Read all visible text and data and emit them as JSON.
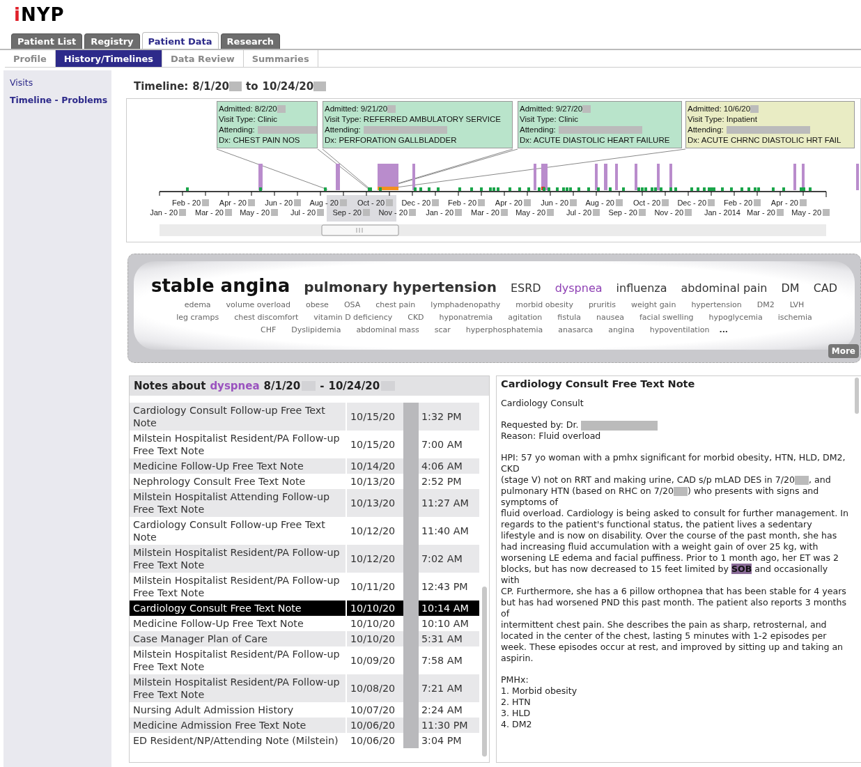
{
  "logo": "iNYP",
  "tabs": [
    {
      "label": "Patient List",
      "selected": false
    },
    {
      "label": "Registry",
      "selected": false
    },
    {
      "label": "Patient Data",
      "selected": true
    },
    {
      "label": "Research",
      "selected": false
    }
  ],
  "subtabs": [
    {
      "label": "Profile",
      "selected": false
    },
    {
      "label": "History/Timelines",
      "selected": true
    },
    {
      "label": "Data Review",
      "selected": false
    },
    {
      "label": "Summaries",
      "selected": false
    }
  ],
  "sidebar": {
    "items": [
      "Visits",
      "Timeline - Problems"
    ]
  },
  "timeline": {
    "label": "Timeline:",
    "start": "8/1/20",
    "separator": "to",
    "end": "10/24/20",
    "visits": [
      {
        "admitted": "Admitted: 8/2/20",
        "visit_type": "Visit Type: Clinic",
        "attending": "Attending:",
        "dx": "Dx: CHEST PAIN NOS",
        "color": "#b9e4cb"
      },
      {
        "admitted": "Admitted: 9/21/20",
        "visit_type": "Visit Type: REFERRED AMBULATORY SERVICE",
        "attending": "Attending:",
        "dx": "Dx: PERFORATION GALLBLADDER",
        "color": "#b9e4cb"
      },
      {
        "admitted": "Admitted: 9/27/20",
        "visit_type": "Visit Type: Clinic",
        "attending": "Attending:",
        "dx": "Dx: ACUTE DIASTOLIC HEART FAILURE",
        "color": "#b9e4cb"
      },
      {
        "admitted": "Admitted: 10/6/20",
        "visit_type": "Visit Type: Inpatient",
        "attending": "Attending:",
        "dx": "Dx: ACUTE CHRNC DIASTOLIC HRT FAIL",
        "color": "#e9ecc4"
      }
    ],
    "months": [
      {
        "label": "Jan - 20",
        "redacted": true
      },
      {
        "label": "Feb - 20",
        "redacted": true
      },
      {
        "label": "Mar - 20",
        "redacted": true
      },
      {
        "label": "Apr - 20",
        "redacted": true
      },
      {
        "label": "May - 20",
        "redacted": true
      },
      {
        "label": "Jun - 20",
        "redacted": true
      },
      {
        "label": "Jul - 20",
        "redacted": true
      },
      {
        "label": "Aug - 20",
        "redacted": true
      },
      {
        "label": "Sep - 20",
        "redacted": true
      },
      {
        "label": "Oct - 20",
        "redacted": true
      },
      {
        "label": "Nov - 20",
        "redacted": true
      },
      {
        "label": "Dec - 20",
        "redacted": true
      },
      {
        "label": "Jan - 20",
        "redacted": true
      },
      {
        "label": "Feb - 20",
        "redacted": true
      },
      {
        "label": "Mar - 20",
        "redacted": true
      },
      {
        "label": "Apr - 20",
        "redacted": true
      },
      {
        "label": "May - 20",
        "redacted": true
      },
      {
        "label": "Jun - 20",
        "redacted": true
      },
      {
        "label": "Jul - 20",
        "redacted": true
      },
      {
        "label": "Aug - 20",
        "redacted": true
      },
      {
        "label": "Sep - 20",
        "redacted": true
      },
      {
        "label": "Oct - 20",
        "redacted": true
      },
      {
        "label": "Nov - 20",
        "redacted": true
      },
      {
        "label": "Dec - 20",
        "redacted": true
      },
      {
        "label": "Jan - 2014",
        "redacted": false
      },
      {
        "label": "Feb - 20",
        "redacted": true
      },
      {
        "label": "Mar - 20",
        "redacted": true
      },
      {
        "label": "Apr - 20",
        "redacted": true
      },
      {
        "label": "May - 20",
        "redacted": true
      }
    ]
  },
  "problems": {
    "lines": [
      [
        {
          "label": "stable angina",
          "kind": "xl",
          "selected": false
        },
        {
          "label": "pulmonary hypertension",
          "kind": "lg",
          "selected": false
        },
        {
          "label": "ESRD",
          "kind": "md",
          "selected": false
        },
        {
          "label": "dyspnea",
          "kind": "md",
          "selected": true
        },
        {
          "label": "influenza",
          "kind": "md",
          "selected": false
        },
        {
          "label": "abdominal pain",
          "kind": "md",
          "selected": false
        },
        {
          "label": "DM",
          "kind": "md",
          "selected": false
        },
        {
          "label": "CAD",
          "kind": "md",
          "selected": false
        }
      ],
      [
        {
          "label": "edema",
          "kind": "sm",
          "selected": false
        },
        {
          "label": "volume overload",
          "kind": "sm",
          "selected": false
        },
        {
          "label": "obese",
          "kind": "sm",
          "selected": false
        },
        {
          "label": "OSA",
          "kind": "sm",
          "selected": false
        },
        {
          "label": "chest pain",
          "kind": "sm",
          "selected": false
        },
        {
          "label": "lymphadenopathy",
          "kind": "sm",
          "selected": false
        },
        {
          "label": "morbid obesity",
          "kind": "sm",
          "selected": false
        },
        {
          "label": "pruritis",
          "kind": "sm",
          "selected": false
        },
        {
          "label": "weight gain",
          "kind": "sm",
          "selected": false
        },
        {
          "label": "hypertension",
          "kind": "sm",
          "selected": false
        },
        {
          "label": "DM2",
          "kind": "sm",
          "selected": false
        },
        {
          "label": "LVH",
          "kind": "sm",
          "selected": false
        }
      ],
      [
        {
          "label": "leg cramps",
          "kind": "sm",
          "selected": false
        },
        {
          "label": "chest discomfort",
          "kind": "sm",
          "selected": false
        },
        {
          "label": "vitamin D deficiency",
          "kind": "sm",
          "selected": false
        },
        {
          "label": "CKD",
          "kind": "sm",
          "selected": false
        },
        {
          "label": "hyponatremia",
          "kind": "sm",
          "selected": false
        },
        {
          "label": "agitation",
          "kind": "sm",
          "selected": false
        },
        {
          "label": "fistula",
          "kind": "sm",
          "selected": false
        },
        {
          "label": "nausea",
          "kind": "sm",
          "selected": false
        },
        {
          "label": "facial swelling",
          "kind": "sm",
          "selected": false
        },
        {
          "label": "hypoglycemia",
          "kind": "sm",
          "selected": false
        },
        {
          "label": "ischemia",
          "kind": "sm",
          "selected": false
        }
      ],
      [
        {
          "label": "CHF",
          "kind": "sm",
          "selected": false
        },
        {
          "label": "Dyslipidemia",
          "kind": "sm",
          "selected": false
        },
        {
          "label": "abdominal mass",
          "kind": "sm",
          "selected": false
        },
        {
          "label": "scar",
          "kind": "sm",
          "selected": false
        },
        {
          "label": "hyperphosphatemia",
          "kind": "sm",
          "selected": false
        },
        {
          "label": "anasarca",
          "kind": "sm",
          "selected": false
        },
        {
          "label": "angina",
          "kind": "sm",
          "selected": false
        },
        {
          "label": "hypoventilation",
          "kind": "sm",
          "selected": false
        }
      ]
    ],
    "ellipsis": "...",
    "more": "More"
  },
  "notes": {
    "label": "Notes about",
    "problem": "dyspnea",
    "start": "8/1/20",
    "separator": "-",
    "end": "10/24/20",
    "rows": [
      {
        "title": "Cardiology Consult Follow-up Free Text Note",
        "date": "10/15/20",
        "time": "1:32 PM",
        "selected": false
      },
      {
        "title": "Milstein Hospitalist Resident/PA Follow-up Free Text Note",
        "date": "10/15/20",
        "time": "7:00 AM",
        "selected": false
      },
      {
        "title": "Medicine Follow-Up Free Text Note",
        "date": "10/14/20",
        "time": "4:06 AM",
        "selected": false
      },
      {
        "title": "Nephrology Consult Free Text Note",
        "date": "10/13/20",
        "time": "2:52 PM",
        "selected": false
      },
      {
        "title": "Milstein Hospitalist Attending Follow-up Free Text Note",
        "date": "10/13/20",
        "time": "11:27 AM",
        "selected": false
      },
      {
        "title": "Cardiology Consult Follow-up Free Text Note",
        "date": "10/12/20",
        "time": "11:40 AM",
        "selected": false
      },
      {
        "title": "Milstein Hospitalist Resident/PA Follow-up Free Text Note",
        "date": "10/12/20",
        "time": "7:02 AM",
        "selected": false
      },
      {
        "title": "Milstein Hospitalist Resident/PA Follow-up Free Text Note",
        "date": "10/11/20",
        "time": "12:43 PM",
        "selected": false
      },
      {
        "title": "Cardiology Consult Free Text Note",
        "date": "10/10/20",
        "time": "10:14 AM",
        "selected": true
      },
      {
        "title": "Medicine Follow-Up Free Text Note",
        "date": "10/10/20",
        "time": "10:10 AM",
        "selected": false
      },
      {
        "title": "Case Manager Plan of Care",
        "date": "10/10/20",
        "time": "5:31 AM",
        "selected": false
      },
      {
        "title": "Milstein Hospitalist Resident/PA Follow-up Free Text Note",
        "date": "10/09/20",
        "time": "7:58 AM",
        "selected": false
      },
      {
        "title": "Milstein Hospitalist Resident/PA Follow-up Free Text Note",
        "date": "10/08/20",
        "time": "7:21 AM",
        "selected": false
      },
      {
        "title": "Nursing Adult Admission History",
        "date": "10/07/20",
        "time": "2:24 AM",
        "selected": false
      },
      {
        "title": "Medicine Admission Free Text Note",
        "date": "10/06/20",
        "time": "11:30 PM",
        "selected": false
      },
      {
        "title": "ED Resident/NP/Attending Note (Milstein)",
        "date": "10/06/20",
        "time": "3:04 PM",
        "selected": false
      }
    ]
  },
  "note": {
    "title": "Cardiology Consult Free Text Note",
    "blocks": [
      [
        {
          "parts": [
            "Cardiology Consult"
          ]
        }
      ],
      [
        {
          "parts": [
            "Requested by: Dr."
          ],
          "trailing_redaction": true
        },
        {
          "parts": [
            "Reason: Fluid overload"
          ]
        }
      ],
      [
        {
          "parts": [
            "HPI: 57 yo woman with a pmhx significant for morbid obesity, HTN, HLD, DM2, CKD"
          ]
        },
        {
          "parts": [
            "(stage V) not on RRT and making urine, CAD s/p mLAD DES in 7/20",
            ", and pulmonary HTN (based on RHC on 7/20",
            ") who presents with signs and symptoms of"
          ]
        },
        {
          "parts": [
            "fluid overload. Cardiology  is being asked to consult for further management. In regards to the patient's functional status, the patient lives a sedentary lifestyle and is now on disability. Over the course of the past month, she has had increasing fluid accumulation with a weight gain of over 25 kg, with worsening LE edema and facial puffiness.  Prior to 1 month ago, her ET was 2"
          ]
        },
        {
          "parts": [
            "blocks, but has now decreased to 15 feet limited by **SOB** and  occasionally with"
          ]
        },
        {
          "parts": [
            "CP. Furthermore, she  has a 6 pillow orthopnea that has been stable for 4 years"
          ]
        },
        {
          "parts": [
            "but has had worsened PND this past month. The patient also reports 3 months of"
          ]
        },
        {
          "parts": [
            "intermittent chest pain. She describes the pain as sharp, retrosternal, and located in the center of the chest, lasting 5 minutes with 1-2 episodes per week. These episodes occur at rest, and improved by sitting up and taking an"
          ]
        },
        {
          "parts": [
            "aspirin."
          ]
        }
      ],
      [
        {
          "parts": [
            "PMHx:"
          ]
        },
        {
          "parts": [
            "1. Morbid obesity"
          ]
        },
        {
          "parts": [
            "2. HTN"
          ]
        },
        {
          "parts": [
            "3. HLD"
          ]
        },
        {
          "parts": [
            "4. DM2"
          ]
        }
      ]
    ]
  }
}
